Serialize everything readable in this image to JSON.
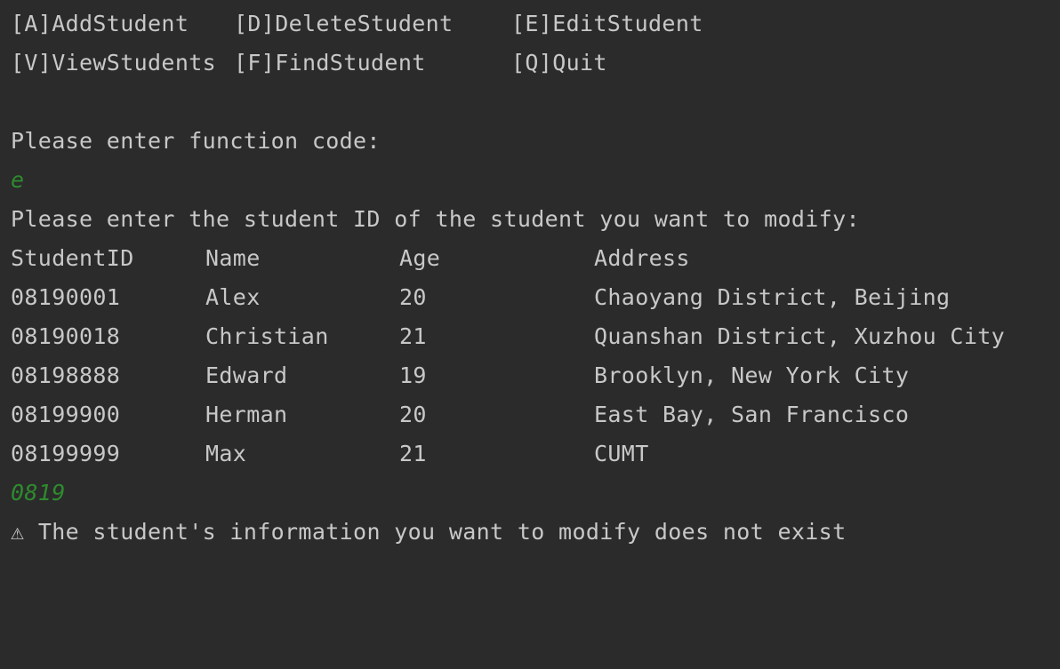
{
  "menu": {
    "row1": [
      "[A]AddStudent",
      "[D]DeleteStudent",
      "[E]EditStudent"
    ],
    "row2": [
      "[V]ViewStudents",
      "[F]FindStudent",
      "[Q]Quit"
    ]
  },
  "prompts": {
    "function_code": "Please enter function code:",
    "function_input": "e",
    "student_id": "Please enter the student ID of the student you want to modify:"
  },
  "table": {
    "headers": [
      "StudentID",
      "Name",
      "Age",
      "Address"
    ],
    "rows": [
      [
        "08190001",
        "Alex",
        "20",
        "Chaoyang District, Beijing"
      ],
      [
        "08190018",
        "Christian",
        "21",
        "Quanshan District, Xuzhou City"
      ],
      [
        "08198888",
        "Edward",
        "19",
        "Brooklyn, New York City"
      ],
      [
        "08199900",
        "Herman",
        "20",
        "East Bay, San Francisco"
      ],
      [
        "08199999",
        "Max",
        "21",
        "CUMT"
      ]
    ]
  },
  "id_input": "0819",
  "warning": {
    "icon": "⚠",
    "message": "The student's information you want to modify does not exist"
  },
  "colors": {
    "background": "#2b2b2b",
    "text": "#c8c8c8",
    "input": "#2e8b2e"
  }
}
